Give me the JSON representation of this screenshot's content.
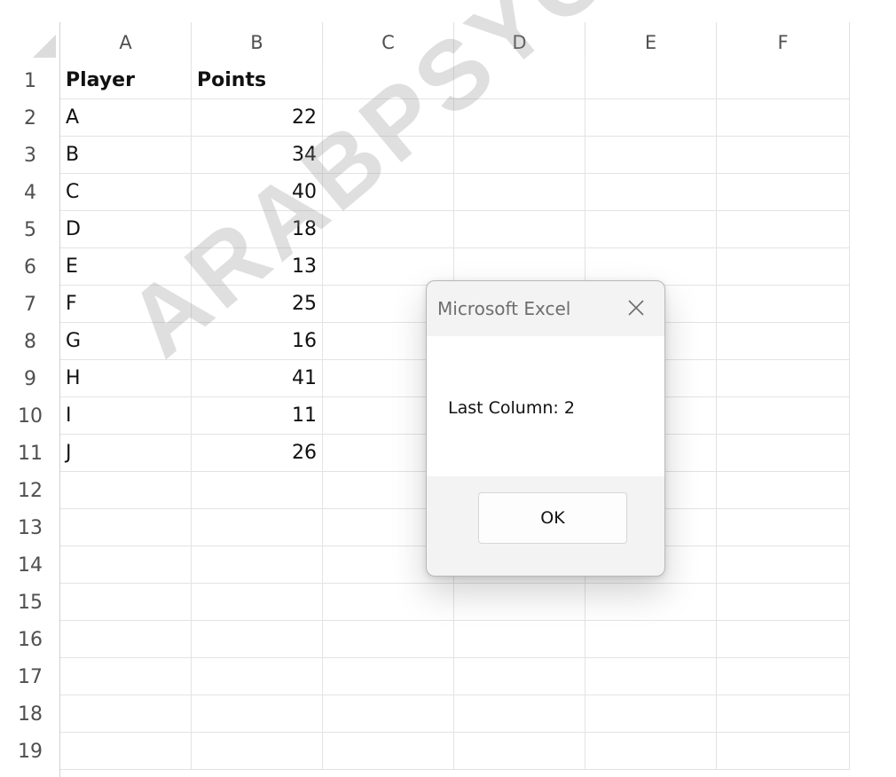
{
  "columns": [
    "A",
    "B",
    "C",
    "D",
    "E",
    "F"
  ],
  "rows": [
    "1",
    "2",
    "3",
    "4",
    "5",
    "6",
    "7",
    "8",
    "9",
    "10",
    "11",
    "12",
    "13",
    "14",
    "15",
    "16",
    "17",
    "18",
    "19"
  ],
  "cells": {
    "header_player": "Player",
    "header_points": "Points",
    "data": [
      {
        "player": "A",
        "points": "22"
      },
      {
        "player": "B",
        "points": "34"
      },
      {
        "player": "C",
        "points": "40"
      },
      {
        "player": "D",
        "points": "18"
      },
      {
        "player": "E",
        "points": "13"
      },
      {
        "player": "F",
        "points": "25"
      },
      {
        "player": "G",
        "points": "16"
      },
      {
        "player": "H",
        "points": "41"
      },
      {
        "player": "I",
        "points": "11"
      },
      {
        "player": "J",
        "points": "26"
      }
    ]
  },
  "watermark": "ARABPSYCHOL",
  "dialog": {
    "title": "Microsoft Excel",
    "message": "Last Column: 2",
    "ok_label": "OK",
    "close_icon": "close-icon"
  },
  "colors": {
    "gridline": "#e3e3e3",
    "header_text": "#505050",
    "dialog_bg": "#f3f3f3"
  }
}
